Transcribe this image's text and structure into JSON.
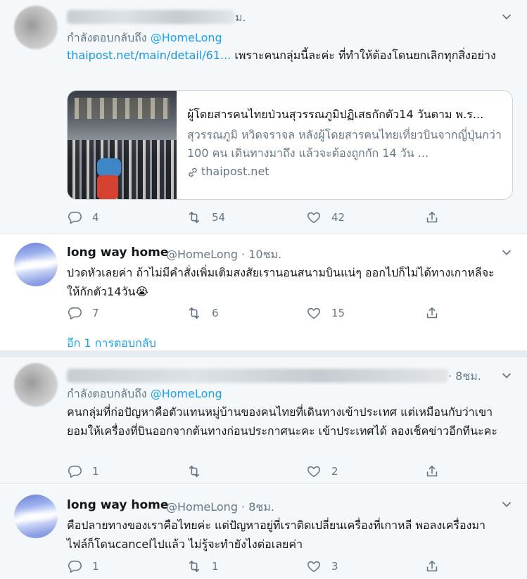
{
  "tweets": [
    {
      "time_tail": "ม.",
      "replying_to": "กำลังตอบกลับถึง",
      "mention": "@HomeLong",
      "link": "thaipost.net/main/detail/61...",
      "text_after_link": "  เพราะคนกลุ่มนี้ละค่ะ ที่ทำให้ต้องโดนยกเลิกทุกสิ่งอย่าง",
      "card": {
        "title": "ผู้โดยสารคนไทยป่วนสุวรรณภูมิปฏิเสธกักตัว14 วันตาม พ.ร...",
        "description": "สุวรรณภูมิ หวิดจราจล หลังผู้โดยสารคนไทยเที่ยวบินจากญี่ปุ่นกว่า 100 คน เดินทางมาถึง แล้วจะต้องถูกกัก 14 วัน ...",
        "domain": "thaipost.net"
      },
      "actions": {
        "reply": "4",
        "retweet": "54",
        "like": "42"
      }
    },
    {
      "name": "long way home",
      "handle": "@HomeLong · 10ชม.",
      "text": "ปวดหัวเลยค่า ถ้าไม่มีคำสั่งเพิ่มเติมสงสัยเรานอนสนามบินแน่ๆ ออกไปก็ไม่ได้ทางเกาหลีจะให้กักตัว14วัน😭",
      "actions": {
        "reply": "7",
        "retweet": "6",
        "like": "15"
      },
      "more_replies": "อีก 1 การตอบกลับ"
    },
    {
      "time_tail": "· 8ชม.",
      "replying_to": "กำลังตอบกลับถึง",
      "mention": "@HomeLong",
      "text": "คนกลุ่มที่ก่อปัญหาคือตัวแทนหมู่บ้านของคนไทยที่เดินทางเข้าประเทศ  แต่เหมือนกับว่าเขายอมให้เครื่องที่บินออกจากต้นทางก่อนประกาศนะคะ เข้าประเทศได้ ลองเช็คข่าวอีกทีนะคะ",
      "actions": {
        "reply": "1",
        "retweet": "",
        "like": "2"
      }
    },
    {
      "name": "long way home",
      "handle": "@HomeLong · 8ชม.",
      "text": "คือปลายทางของเราคือไทยค่ะ แต่ปัญหาอยู่ที่เราติดเปลี่ยนเครื่องที่เกาหลี พอลงเครื่องมาไฟล์ก็โดนcancelไปแล้ว ไม่รู้จะทำยังไงต่อเลยค่า",
      "actions": {
        "reply": "1",
        "retweet": "1",
        "like": "3"
      }
    }
  ],
  "icons": {
    "reply": "reply-icon",
    "retweet": "retweet-icon",
    "like": "like-icon",
    "share": "share-icon",
    "menu": "chevron-down-icon",
    "link": "link-icon"
  },
  "colors": {
    "accent": "#1da1f2",
    "muted": "#657786",
    "border": "#e6ecf0"
  }
}
